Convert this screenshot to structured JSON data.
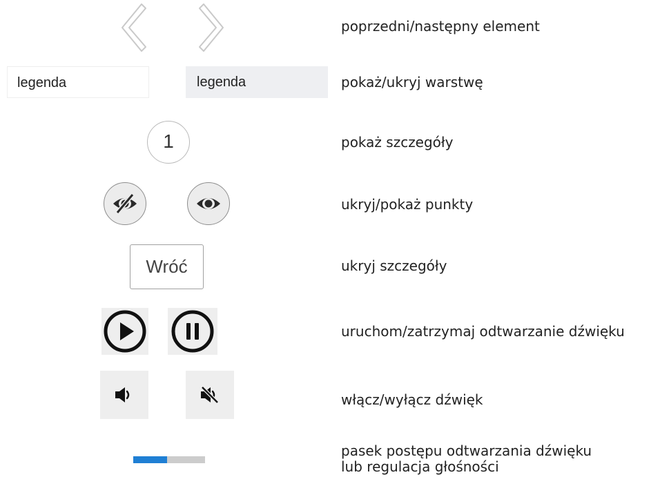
{
  "rows": {
    "nav": {
      "description": "poprzedni/następny element",
      "prev_icon": "chevron-left-icon",
      "next_icon": "chevron-right-icon"
    },
    "legend": {
      "description": "pokaż/ukryj warstwę",
      "button_off_label": "legenda",
      "button_on_label": "legenda"
    },
    "details": {
      "description": "pokaż szczegóły",
      "number_label": "1"
    },
    "points": {
      "description": "ukryj/pokaż punkty",
      "hide_icon": "eye-slash-icon",
      "show_icon": "eye-icon"
    },
    "back": {
      "description": "ukryj szczegóły",
      "button_label": "Wróć"
    },
    "playback": {
      "description": "uruchom/zatrzymaj odtwarzanie dźwięku",
      "play_icon": "play-circle-icon",
      "pause_icon": "pause-circle-icon"
    },
    "mute": {
      "description": "włącz/wyłącz dźwięk",
      "on_icon": "volume-icon",
      "off_icon": "volume-mute-icon"
    },
    "progress": {
      "description_line1": "pasek postępu odtwarzania dźwięku",
      "description_line2": "lub regulacja głośności",
      "value_percent": 47
    }
  },
  "colors": {
    "progress_fill": "#1f7fd4",
    "progress_track": "#cccccc",
    "active_legend_bg": "#eeeff2",
    "media_bg": "#eeeeee"
  }
}
